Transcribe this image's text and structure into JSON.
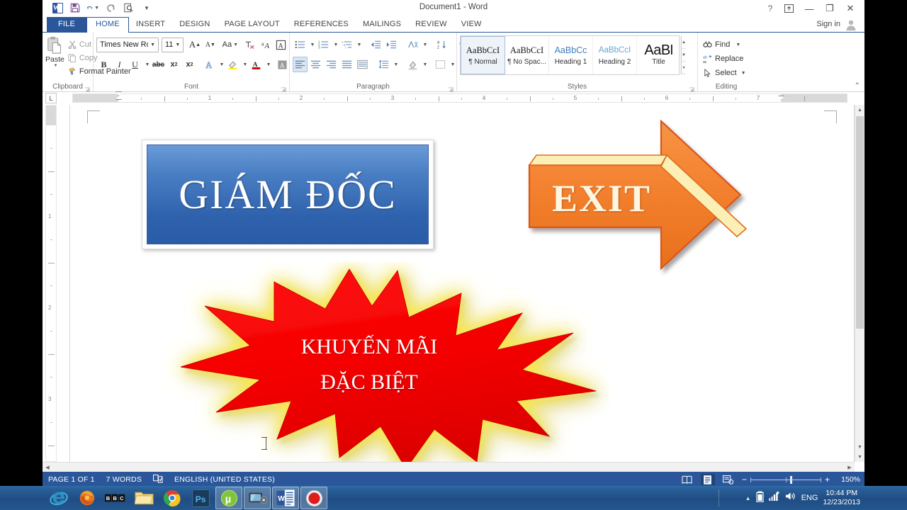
{
  "window": {
    "title": "Document1 - Word",
    "sign_in": "Sign in",
    "help_glyph": "?",
    "ribbon_display_icon": "ribbon-display-options-icon",
    "minimize_glyph": "—",
    "restore_glyph": "❐",
    "close_glyph": "✕"
  },
  "qat": [
    {
      "name": "word-logo-icon",
      "label": "W"
    },
    {
      "name": "save-icon"
    },
    {
      "name": "undo-icon"
    },
    {
      "name": "redo-icon"
    },
    {
      "name": "print-preview-icon"
    },
    {
      "name": "customize-qat-icon"
    }
  ],
  "tabs": [
    {
      "label": "FILE",
      "kind": "file"
    },
    {
      "label": "HOME",
      "kind": "active"
    },
    {
      "label": "INSERT",
      "kind": "normal"
    },
    {
      "label": "DESIGN",
      "kind": "normal"
    },
    {
      "label": "PAGE LAYOUT",
      "kind": "normal"
    },
    {
      "label": "REFERENCES",
      "kind": "normal"
    },
    {
      "label": "MAILINGS",
      "kind": "normal"
    },
    {
      "label": "REVIEW",
      "kind": "normal"
    },
    {
      "label": "VIEW",
      "kind": "normal"
    }
  ],
  "ribbon": {
    "collapse_glyph": "⌃",
    "clipboard": {
      "group_label": "Clipboard",
      "paste_label": "Paste",
      "cut_label": "Cut",
      "copy_label": "Copy",
      "format_painter_label": "Format Painter"
    },
    "font": {
      "group_label": "Font",
      "font_name": "Times New Ro",
      "font_size": "11",
      "grow_font": "A",
      "shrink_font": "A",
      "change_case": "Aa",
      "clear_formatting": "clear-formatting-icon",
      "text_effects": "text-effects-icon",
      "bold": "B",
      "italic": "I",
      "underline": "U",
      "strikethrough": "abc",
      "subscript": "x",
      "superscript": "x",
      "highlight": "highlight-icon",
      "font_color": "A",
      "phonetic": "phonetic-guide-icon",
      "enclose": "enclose-characters-icon"
    },
    "paragraph": {
      "group_label": "Paragraph",
      "bullets": "bullets-icon",
      "numbering": "numbering-icon",
      "multilevel": "multilevel-list-icon",
      "decrease_indent": "decrease-indent-icon",
      "increase_indent": "increase-indent-icon",
      "asian_layout": "asian-layout-icon",
      "sort": "sort-icon",
      "show_marks": "¶",
      "align_left": "align-left-icon",
      "align_center": "align-center-icon",
      "align_right": "align-right-icon",
      "justify": "justify-icon",
      "distributed": "distributed-icon",
      "line_spacing": "line-spacing-icon",
      "shading": "shading-icon",
      "borders": "borders-icon"
    },
    "styles": {
      "group_label": "Styles",
      "items": [
        {
          "preview": "AaBbCcI",
          "name": "¶ Normal",
          "kind": "normal",
          "selected": true
        },
        {
          "preview": "AaBbCcI",
          "name": "¶ No Spac...",
          "kind": "normal",
          "selected": false
        },
        {
          "preview": "AaBbCc",
          "name": "Heading 1",
          "kind": "h1",
          "selected": false
        },
        {
          "preview": "AaBbCcI",
          "name": "Heading 2",
          "kind": "h2",
          "selected": false
        },
        {
          "preview": "AaBl",
          "name": "Title",
          "kind": "tt",
          "selected": false
        }
      ]
    },
    "editing": {
      "group_label": "Editing",
      "find_label": "Find",
      "replace_label": "Replace",
      "select_label": "Select"
    }
  },
  "ruler": {
    "corner_tab": "L",
    "h_numbers": [
      "1",
      "2",
      "3",
      "4",
      "5",
      "6",
      "7"
    ],
    "v_numbers": [
      "1",
      "2",
      "3"
    ]
  },
  "document": {
    "banner": {
      "text": "GIÁM ĐỐC",
      "fill_color": "#3f70ba"
    },
    "arrow": {
      "text": "EXIT",
      "fill_color": "#f07d2a",
      "bevel_color": "#fbefb5"
    },
    "burst": {
      "line1": "KHUYẾN MÃI",
      "line2": "ĐẶC BIỆT",
      "fill_color": "#f50000",
      "glow_color": "#fbe94a"
    }
  },
  "statusbar": {
    "page": "PAGE 1 OF 1",
    "words": "7 WORDS",
    "proofing_icon": "proofing-errors-icon",
    "language": "ENGLISH (UNITED STATES)",
    "view_read": "read-mode-icon",
    "view_print": "print-layout-icon",
    "view_web": "web-layout-icon",
    "zoom_out": "−",
    "zoom_in": "+",
    "zoom_level": "150%"
  },
  "taskbar": {
    "apps": [
      {
        "name": "internet-explorer-icon",
        "label": "e"
      },
      {
        "name": "firefox-icon",
        "label": ""
      },
      {
        "name": "bbc-iplayer-icon",
        "label": "BBC"
      },
      {
        "name": "file-explorer-icon",
        "label": ""
      },
      {
        "name": "google-chrome-icon",
        "label": ""
      },
      {
        "name": "photoshop-icon",
        "label": "Ps"
      },
      {
        "name": "utorrent-icon",
        "label": "µ"
      },
      {
        "name": "tv-app-icon",
        "label": ""
      },
      {
        "name": "word-taskbar-icon",
        "label": "W"
      },
      {
        "name": "screen-recorder-icon",
        "label": ""
      }
    ],
    "tray": {
      "show_hidden_icons": "▲",
      "battery_icon": "battery-icon",
      "network_icon": "network-icon",
      "volume_icon": "volume-icon",
      "language": "ENG",
      "time": "10:44 PM",
      "date": "12/23/2013"
    }
  }
}
